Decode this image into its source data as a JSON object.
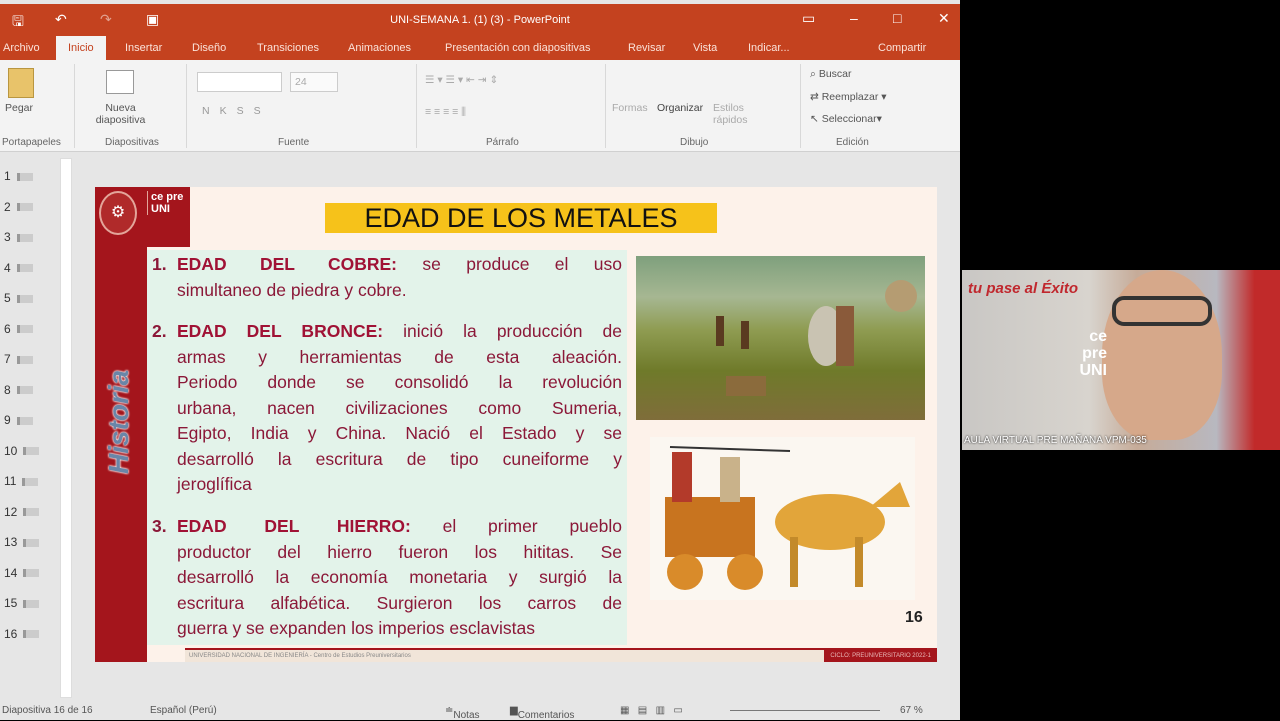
{
  "window": {
    "title": "UNI-SEMANA 1. (1) (3) - PowerPoint"
  },
  "tabs": [
    "Archivo",
    "Inicio",
    "Insertar",
    "Diseño",
    "Transiciones",
    "Animaciones",
    "Presentación con diapositivas",
    "Revisar",
    "Vista",
    "Indicar...",
    "Compartir"
  ],
  "ribbon": {
    "paste": "Pegar",
    "new_slide": "Nueva diapositiva",
    "font_size": "24",
    "format_buttons": [
      "N",
      "K",
      "S",
      "S"
    ],
    "shapes": "Formas",
    "arrange": "Organizar",
    "styles": "Estilos rápidos",
    "find": "Buscar",
    "replace": "Reemplazar",
    "select": "Seleccionar",
    "groups": [
      "Portapapeles",
      "Diapositivas",
      "Fuente",
      "Párrafo",
      "Dibujo",
      "Edición"
    ]
  },
  "thumbnails": [
    "1",
    "2",
    "3",
    "4",
    "5",
    "6",
    "7",
    "8",
    "9",
    "10",
    "11",
    "12",
    "13",
    "14",
    "15",
    "16"
  ],
  "slide": {
    "title": "EDAD DE LOS METALES",
    "brand": "ce pre UNI",
    "sidebar_word": "Historia",
    "items": [
      {
        "num": "1.",
        "lines": [
          {
            "h": "EDAD DEL COBRE:",
            "t": " se produce el uso"
          },
          {
            "t": "simultaneo de piedra y cobre."
          }
        ]
      },
      {
        "num": "2.",
        "lines": [
          {
            "h": "EDAD DEL BRONCE:",
            "t": " inició la producción de"
          },
          {
            "t": "armas y herramientas de esta aleación."
          },
          {
            "t": "Periodo donde se consolidó la revolución"
          },
          {
            "t": "urbana, nacen civilizaciones como  Sumeria,"
          },
          {
            "t": "Egipto, India y China. Nació el Estado y se"
          },
          {
            "t": "desarrolló la escritura de tipo cuneiforme y"
          },
          {
            "t": "jeroglífica"
          }
        ]
      },
      {
        "num": "3.",
        "lines": [
          {
            "h": "EDAD DEL HIERRO:",
            "t": " el primer pueblo"
          },
          {
            "t": "productor del hierro fueron los hititas. Se"
          },
          {
            "t": "desarrolló la economía monetaria y surgió la"
          },
          {
            "t": "escritura alfabética. Surgieron los carros de"
          },
          {
            "t": "guerra y se expanden los imperios esclavistas"
          }
        ]
      }
    ],
    "page_number": "16",
    "footer_left": "UNIVERSIDAD NACIONAL DE INGENIERÍA - Centro de Estudios Preuniversitarios",
    "footer_right": "CICLO: PREUNIVERSITARIO 2022-1"
  },
  "status": {
    "slide": "Diapositiva 16 de 16",
    "language": "Español (Perú)",
    "notes": "Notas",
    "comments": "Comentarios",
    "zoom": "67 %"
  },
  "webcam": {
    "label": "AULA VIRTUAL PRE MAÑANA VPM-035",
    "script": "tu pase al Éxito",
    "brand": "ce pre UNI"
  }
}
